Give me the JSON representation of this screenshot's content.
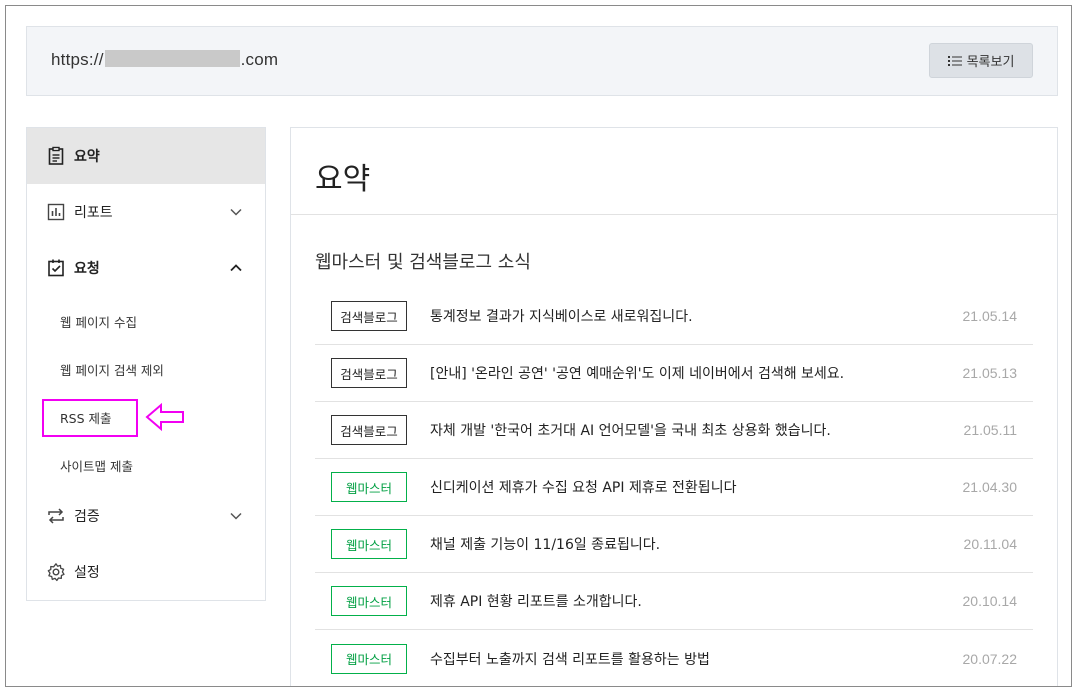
{
  "header": {
    "url_prefix": "https://",
    "url_suffix": ".com",
    "list_button": "목록보기"
  },
  "sidebar": {
    "items": [
      {
        "label": "요약",
        "icon": "clipboard-icon"
      },
      {
        "label": "리포트",
        "icon": "chart-icon"
      },
      {
        "label": "요청",
        "icon": "clipboard-check-icon"
      },
      {
        "label": "검증",
        "icon": "repeat-icon"
      },
      {
        "label": "설정",
        "icon": "gear-icon"
      }
    ],
    "sub_items": [
      {
        "label": "웹 페이지 수집"
      },
      {
        "label": "웹 페이지 검색 제외"
      },
      {
        "label": "RSS 제출"
      },
      {
        "label": "사이트맵 제출"
      }
    ]
  },
  "main": {
    "title": "요약",
    "section_title": "웹마스터 및 검색블로그 소식",
    "news": [
      {
        "tag": "검색블로그",
        "text": "통계정보 결과가 지식베이스로 새로워집니다.",
        "date": "21.05.14"
      },
      {
        "tag": "검색블로그",
        "text": "[안내] '온라인 공연' '공연 예매순위'도 이제 네이버에서 검색해 보세요.",
        "date": "21.05.13"
      },
      {
        "tag": "검색블로그",
        "text": "자체 개발 '한국어 초거대 AI 언어모델'을 국내 최초 상용화 했습니다.",
        "date": "21.05.11"
      },
      {
        "tag": "웹마스터",
        "text": "신디케이션 제휴가 수집 요청 API 제휴로 전환됩니다",
        "date": "21.04.30"
      },
      {
        "tag": "웹마스터",
        "text": "채널 제출 기능이 11/16일 종료됩니다.",
        "date": "20.11.04"
      },
      {
        "tag": "웹마스터",
        "text": "제휴 API 현황 리포트를 소개합니다.",
        "date": "20.10.14"
      },
      {
        "tag": "웹마스터",
        "text": "수집부터 노출까지 검색 리포트를 활용하는 방법",
        "date": "20.07.22"
      }
    ]
  },
  "colors": {
    "highlight": "#f200f2",
    "tag_green": "#03b04a",
    "active_bg": "#e6e6e6"
  }
}
